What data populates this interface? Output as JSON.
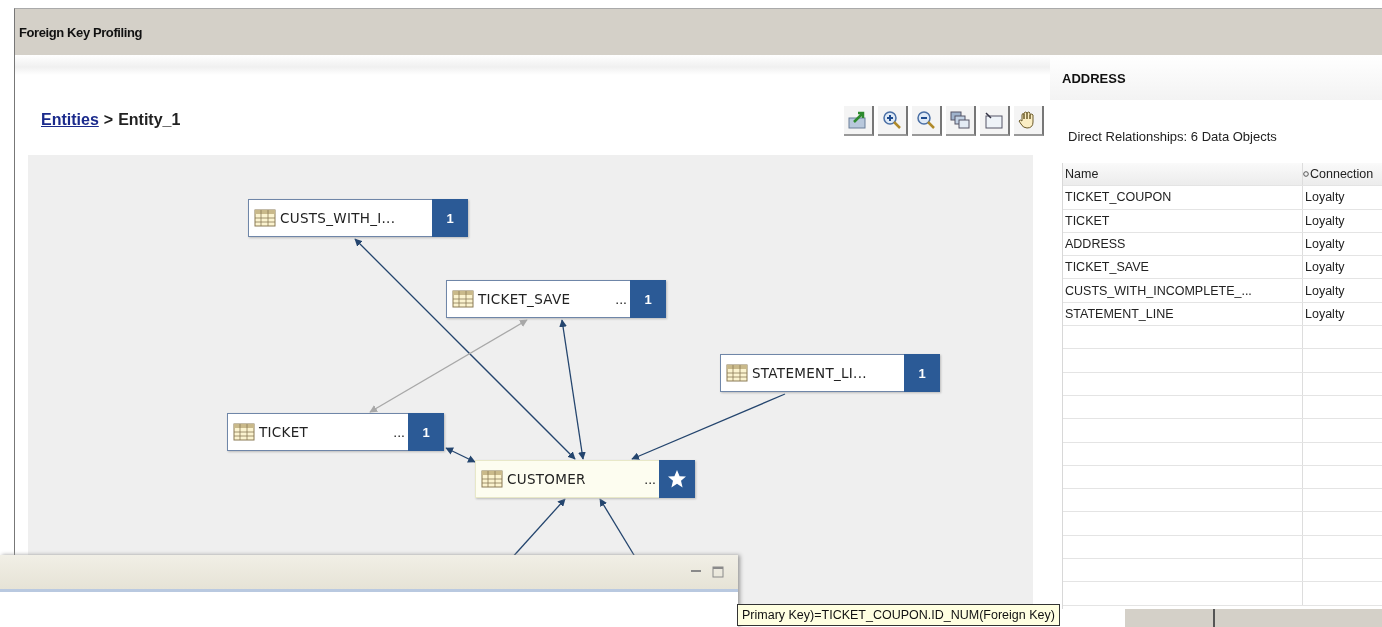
{
  "title": "Foreign Key Profiling",
  "breadcrumb": {
    "link": "Entities",
    "separator": ">",
    "current": "Entity_1"
  },
  "diagram": {
    "nodes": [
      {
        "label": "CUSTS_WITH_I...",
        "kind": "count",
        "badge": "1",
        "selected": false
      },
      {
        "label": "TICKET_SAVE",
        "more": "...",
        "kind": "count",
        "badge": "1",
        "selected": false
      },
      {
        "label": "STATEMENT_LI...",
        "kind": "count",
        "badge": "1",
        "selected": false
      },
      {
        "label": "TICKET",
        "more": "...",
        "kind": "count",
        "badge": "1",
        "selected": false
      },
      {
        "label": "CUSTOMER",
        "more": "...",
        "kind": "star",
        "selected": true
      }
    ]
  },
  "details": {
    "title": "ADDRESS",
    "summary": "Direct Relationships: 6 Data Objects",
    "columns": [
      "Name",
      "Connection"
    ],
    "rows": [
      [
        "TICKET_COUPON",
        "Loyalty"
      ],
      [
        "TICKET",
        "Loyalty"
      ],
      [
        "ADDRESS",
        "Loyalty"
      ],
      [
        "TICKET_SAVE",
        "Loyalty"
      ],
      [
        "CUSTS_WITH_INCOMPLETE_...",
        "Loyalty"
      ],
      [
        "STATEMENT_LINE",
        "Loyalty"
      ]
    ]
  },
  "tooltip": "Primary Key)=TICKET_COUPON.ID_NUM(Foreign Key)"
}
